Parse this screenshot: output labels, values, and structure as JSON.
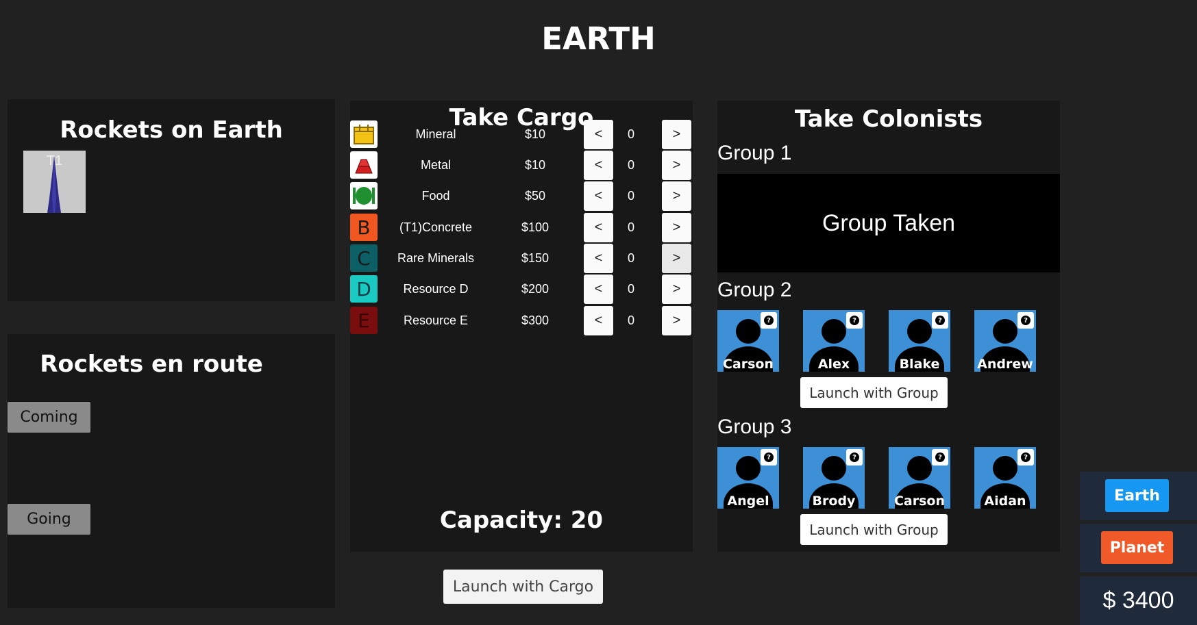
{
  "title": "EARTH",
  "rockets_panel": {
    "heading": "Rockets on Earth",
    "rocket_label": "T1"
  },
  "enroute_panel": {
    "heading": "Rockets en route",
    "coming_label": "Coming",
    "going_label": "Going"
  },
  "cargo": {
    "heading": "Take Cargo",
    "items": [
      {
        "name": "Mineral",
        "price": "$10",
        "qty": "0",
        "icon": "mineral-crate-icon",
        "letter": "",
        "color": "#ffffff"
      },
      {
        "name": "Metal",
        "price": "$10",
        "qty": "0",
        "icon": "metal-ingot-icon",
        "letter": "",
        "color": "#ffffff"
      },
      {
        "name": "Food",
        "price": "$50",
        "qty": "0",
        "icon": "food-plate-icon",
        "letter": "",
        "color": "#ffffff"
      },
      {
        "name": "(T1)Concrete",
        "price": "$100",
        "qty": "0",
        "icon": "letter-b-icon",
        "letter": "B",
        "color": "#f0561f"
      },
      {
        "name": "Rare Minerals",
        "price": "$150",
        "qty": "0",
        "icon": "letter-c-icon",
        "letter": "C",
        "color": "#0d5f66"
      },
      {
        "name": "Resource D",
        "price": "$200",
        "qty": "0",
        "icon": "letter-d-icon",
        "letter": "D",
        "color": "#19c9c2"
      },
      {
        "name": "Resource E",
        "price": "$300",
        "qty": "0",
        "icon": "letter-e-icon",
        "letter": "E",
        "color": "#7a0d0d"
      }
    ],
    "decrement_label": "<",
    "increment_label": ">",
    "capacity": "Capacity: 20",
    "launch_label": "Launch with Cargo"
  },
  "colonists": {
    "heading": "Take Colonists",
    "group1": {
      "label": "Group 1",
      "status": "Group Taken"
    },
    "group2": {
      "label": "Group 2",
      "members": [
        "Carson",
        "Alex",
        "Blake",
        "Andrew"
      ],
      "launch_label": "Launch with Group"
    },
    "group3": {
      "label": "Group 3",
      "members": [
        "Angel",
        "Brody",
        "Carson",
        "Aidan"
      ],
      "launch_label": "Launch with Group"
    },
    "help_mark": "?"
  },
  "nav": {
    "earth_label": "Earth",
    "planet_label": "Planet",
    "earth_color": "#1597f2",
    "planet_color": "#f05a28"
  },
  "money": "$ 3400"
}
